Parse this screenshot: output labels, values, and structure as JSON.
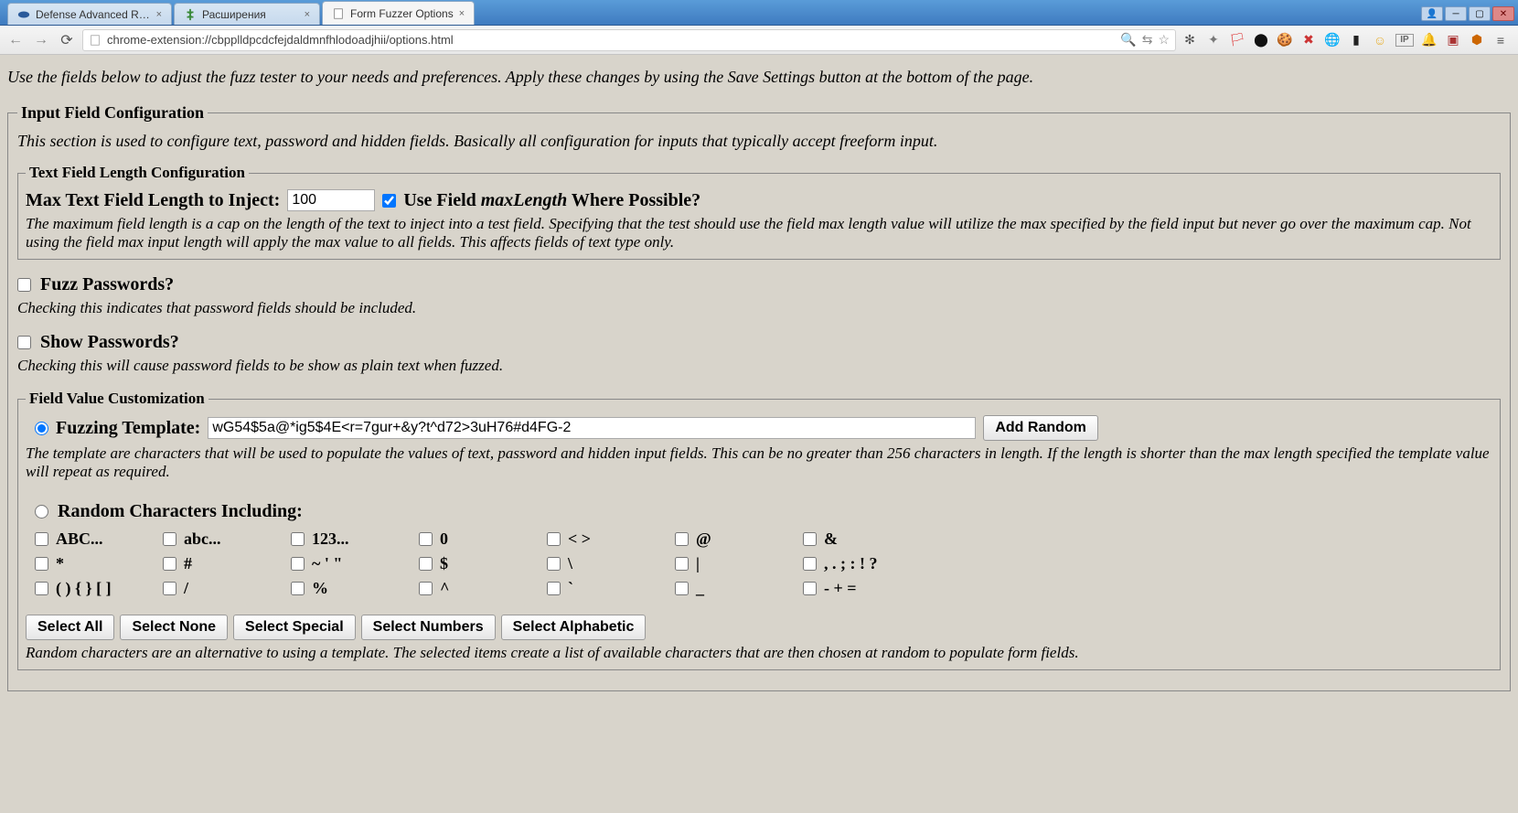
{
  "browser": {
    "tabs": [
      {
        "title": "Defense Advanced Resear"
      },
      {
        "title": "Расширения"
      },
      {
        "title": "Form Fuzzer Options"
      }
    ],
    "window_controls": {
      "user": "👤",
      "min": "─",
      "max": "▢",
      "close": "✕"
    },
    "url": "chrome-extension://cbpplldpcdcfejdaldmnfhlodoadjhii/options.html",
    "nav": {
      "back": "←",
      "forward": "→",
      "reload": "⟳"
    },
    "urlbar_right": {
      "zoom": "🔍",
      "translate": "⇆",
      "star": "☆"
    },
    "ext_icons": [
      {
        "name": "settings-gear",
        "glyph": "✻",
        "color": "#555"
      },
      {
        "name": "hot-icon",
        "glyph": "✦",
        "color": "#777"
      },
      {
        "name": "flag-icon",
        "glyph": "🏳",
        "color": "#d33"
      },
      {
        "name": "record-icon",
        "glyph": "⬤",
        "color": "#111"
      },
      {
        "name": "cookie-icon",
        "glyph": "🍪",
        "color": "#c77"
      },
      {
        "name": "block-icon",
        "glyph": "✖",
        "color": "#c33"
      },
      {
        "name": "globe-icon",
        "glyph": "🌐",
        "color": "#36a"
      },
      {
        "name": "book-icon",
        "glyph": "▮",
        "color": "#222"
      },
      {
        "name": "emoji-icon",
        "glyph": "☺",
        "color": "#e8b030"
      },
      {
        "name": "ip-icon",
        "glyph": "IP",
        "color": "#666"
      },
      {
        "name": "bell-icon",
        "glyph": "🔔",
        "color": "#d44"
      },
      {
        "name": "shield-icon",
        "glyph": "▣",
        "color": "#a33"
      },
      {
        "name": "badge-icon",
        "glyph": "⬢",
        "color": "#c60"
      },
      {
        "name": "menu-icon",
        "glyph": "≡",
        "color": "#555"
      }
    ]
  },
  "page_intro": "Use the fields below to adjust the fuzz tester to your needs and preferences. Apply these changes by using the Save Settings button at the bottom of the page.",
  "input_config": {
    "legend": "Input Field Configuration",
    "desc": "This section is used to configure text, password and hidden fields. Basically all configuration for inputs that typically accept freeform input.",
    "text_len": {
      "legend": "Text Field Length Configuration",
      "label": "Max Text Field Length to Inject:",
      "value": "100",
      "use_maxlength_checked": true,
      "use_maxlength_prefix": "Use Field ",
      "use_maxlength_em": "maxLength",
      "use_maxlength_suffix": " Where Possible?",
      "desc": "The maximum field length is a cap on the length of the text to inject into a test field. Specifying that the test should use the field max length value will utilize the max specified by the field input but never go over the maximum cap. Not using the field max input length will apply the max value to all fields. This affects fields of text type only."
    },
    "fuzz_pw": {
      "label": "Fuzz Passwords?",
      "checked": false,
      "desc": "Checking this indicates that password fields should be included."
    },
    "show_pw": {
      "label": "Show Passwords?",
      "checked": false,
      "desc": "Checking this will cause password fields to be show as plain text when fuzzed."
    },
    "fvc": {
      "legend": "Field Value Customization",
      "template_label": "Fuzzing Template:",
      "template_value": "wG54$5a@*ig5$4E<r=7gur+&y?t^d72>3uH76#d4FG-2",
      "add_random_btn": "Add Random",
      "template_desc": "The template are characters that will be used to populate the values of text, password and hidden input fields. This can be no greater than 256 characters in length. If the length is shorter than the max length specified the template value will repeat as required.",
      "random_radio_label": "Random Characters Including:",
      "char_options": [
        "ABC...",
        "abc...",
        "123...",
        "0",
        "< >",
        "@",
        "&",
        "*",
        "#",
        "~ ' \"",
        "$",
        "\\",
        "|",
        ", . ; : ! ?",
        "( ) { } [ ]",
        "/",
        "%",
        "^",
        "`",
        "_",
        "- + ="
      ],
      "buttons": {
        "select_all": "Select All",
        "select_none": "Select None",
        "select_special": "Select Special",
        "select_numbers": "Select Numbers",
        "select_alpha": "Select Alphabetic"
      },
      "random_desc": "Random characters are an alternative to using a template. The selected items create a list of available characters that are then chosen at random to populate form fields."
    }
  }
}
